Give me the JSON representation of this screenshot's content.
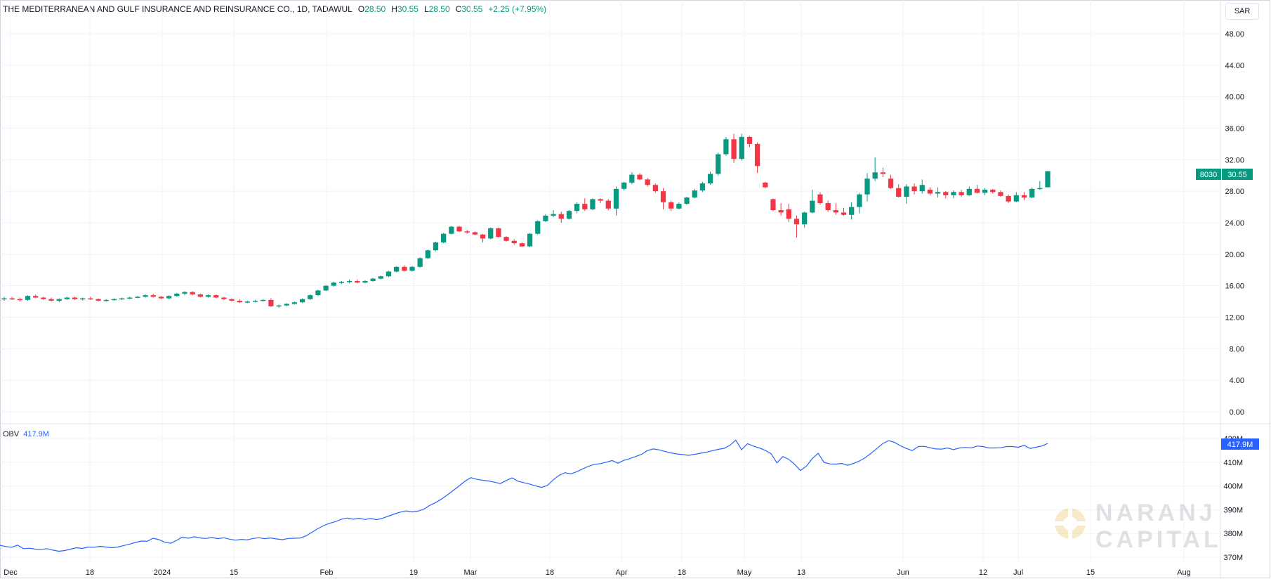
{
  "header": {
    "title": "THE MEDITERRANEAN AND GULF INSURANCE AND REINSURANCE CO., 1D, TADAWUL",
    "open_label": "O",
    "open": "28.50",
    "high_label": "H",
    "high": "30.55",
    "low_label": "L",
    "low": "28.50",
    "close_label": "C",
    "close": "30.55",
    "change": "+2.25 (+7.95%)"
  },
  "currency": "SAR",
  "price_tag": {
    "symbol": "8030",
    "value": "30.55"
  },
  "obv_legend": {
    "name": "OBV",
    "value": "417.9M"
  },
  "obv_tag": "417.9M",
  "watermark": {
    "line1": "NARANJ",
    "line2": "CAPITAL"
  },
  "colors": {
    "up": "#089981",
    "down": "#f23645",
    "obv": "#2962ff",
    "grid": "#f0f3fa",
    "axis_text": "#131722"
  },
  "chart_data": [
    {
      "type": "candlestick",
      "title": "THE MEDITERRANEAN AND GULF INSURANCE AND REINSURANCE CO., 1D, TADAWUL",
      "y_ticks": [
        "48.00",
        "44.00",
        "40.00",
        "36.00",
        "32.00",
        "28.00",
        "24.00",
        "20.00",
        "16.00",
        "12.00",
        "8.00",
        "4.00",
        "0.00"
      ],
      "ylim": [
        0,
        50
      ],
      "x_ticks": [
        "Dec",
        "18",
        "2024",
        "15",
        "Feb",
        "19",
        "Mar",
        "18",
        "Apr",
        "18",
        "May",
        "13",
        "Jun",
        "12",
        "Jul",
        "15",
        "Aug"
      ],
      "grid": true,
      "candles": [
        [
          14.3,
          14.6,
          14.1,
          14.4
        ],
        [
          14.4,
          14.6,
          14.2,
          14.3
        ],
        [
          14.3,
          14.5,
          14.0,
          14.2
        ],
        [
          14.2,
          14.8,
          14.1,
          14.7
        ],
        [
          14.7,
          14.9,
          14.4,
          14.5
        ],
        [
          14.5,
          14.6,
          14.2,
          14.3
        ],
        [
          14.3,
          14.5,
          14.0,
          14.1
        ],
        [
          14.1,
          14.4,
          13.9,
          14.3
        ],
        [
          14.3,
          14.6,
          14.2,
          14.5
        ],
        [
          14.5,
          14.6,
          14.2,
          14.3
        ],
        [
          14.3,
          14.5,
          14.1,
          14.4
        ],
        [
          14.4,
          14.6,
          14.2,
          14.3
        ],
        [
          14.3,
          14.4,
          14.0,
          14.1
        ],
        [
          14.1,
          14.3,
          14.0,
          14.2
        ],
        [
          14.2,
          14.4,
          14.1,
          14.3
        ],
        [
          14.3,
          14.5,
          14.2,
          14.4
        ],
        [
          14.4,
          14.6,
          14.3,
          14.5
        ],
        [
          14.5,
          14.7,
          14.4,
          14.6
        ],
        [
          14.6,
          14.9,
          14.5,
          14.8
        ],
        [
          14.8,
          15.0,
          14.5,
          14.6
        ],
        [
          14.6,
          14.7,
          14.3,
          14.4
        ],
        [
          14.4,
          14.8,
          14.3,
          14.7
        ],
        [
          14.7,
          15.1,
          14.6,
          15.0
        ],
        [
          15.0,
          15.3,
          14.8,
          15.2
        ],
        [
          15.2,
          15.3,
          14.8,
          14.9
        ],
        [
          14.9,
          15.0,
          14.5,
          14.6
        ],
        [
          14.6,
          14.9,
          14.5,
          14.8
        ],
        [
          14.8,
          14.9,
          14.4,
          14.5
        ],
        [
          14.5,
          14.6,
          14.2,
          14.3
        ],
        [
          14.3,
          14.4,
          14.0,
          14.1
        ],
        [
          14.1,
          14.3,
          13.8,
          13.9
        ],
        [
          13.9,
          14.1,
          13.8,
          14.0
        ],
        [
          14.0,
          14.2,
          13.9,
          14.1
        ],
        [
          14.1,
          14.3,
          14.0,
          14.2
        ],
        [
          14.2,
          14.4,
          13.3,
          13.4
        ],
        [
          13.4,
          13.6,
          13.2,
          13.5
        ],
        [
          13.5,
          13.8,
          13.4,
          13.7
        ],
        [
          13.7,
          14.0,
          13.6,
          13.9
        ],
        [
          13.9,
          14.4,
          13.8,
          14.3
        ],
        [
          14.3,
          14.9,
          14.2,
          14.8
        ],
        [
          14.8,
          15.5,
          14.7,
          15.4
        ],
        [
          15.4,
          16.1,
          15.3,
          16.0
        ],
        [
          16.0,
          16.5,
          15.9,
          16.4
        ],
        [
          16.4,
          16.6,
          16.2,
          16.5
        ],
        [
          16.5,
          16.8,
          16.3,
          16.6
        ],
        [
          16.6,
          16.8,
          16.3,
          16.4
        ],
        [
          16.4,
          16.7,
          16.3,
          16.6
        ],
        [
          16.6,
          17.0,
          16.5,
          16.9
        ],
        [
          16.9,
          17.3,
          16.8,
          17.2
        ],
        [
          17.2,
          17.9,
          17.1,
          17.8
        ],
        [
          17.8,
          18.5,
          17.7,
          18.4
        ],
        [
          18.4,
          18.6,
          17.8,
          17.9
        ],
        [
          17.9,
          18.5,
          17.8,
          18.4
        ],
        [
          18.4,
          19.6,
          18.3,
          19.5
        ],
        [
          19.5,
          20.6,
          19.4,
          20.5
        ],
        [
          20.5,
          21.6,
          20.4,
          21.5
        ],
        [
          21.5,
          22.7,
          21.4,
          22.6
        ],
        [
          22.6,
          23.6,
          22.5,
          23.5
        ],
        [
          23.5,
          23.6,
          22.8,
          22.9
        ],
        [
          22.9,
          23.1,
          22.6,
          22.8
        ],
        [
          22.8,
          22.9,
          22.4,
          22.5
        ],
        [
          22.5,
          22.6,
          21.5,
          22.0
        ],
        [
          22.0,
          23.4,
          21.9,
          23.3
        ],
        [
          23.3,
          23.4,
          22.1,
          22.2
        ],
        [
          22.2,
          22.3,
          21.6,
          21.7
        ],
        [
          21.7,
          21.9,
          21.2,
          21.4
        ],
        [
          21.4,
          21.5,
          20.9,
          21.0
        ],
        [
          21.0,
          22.7,
          20.9,
          22.6
        ],
        [
          22.6,
          24.3,
          22.5,
          24.2
        ],
        [
          24.2,
          25.1,
          24.1,
          24.9
        ],
        [
          24.9,
          25.6,
          24.7,
          25.1
        ],
        [
          25.1,
          25.4,
          24.0,
          24.5
        ],
        [
          24.5,
          25.6,
          24.4,
          25.5
        ],
        [
          25.5,
          26.6,
          25.2,
          26.4
        ],
        [
          26.4,
          27.1,
          25.5,
          25.7
        ],
        [
          25.7,
          27.1,
          25.6,
          27.0
        ],
        [
          27.0,
          27.1,
          26.5,
          26.8
        ],
        [
          26.8,
          27.0,
          25.6,
          25.8
        ],
        [
          25.8,
          28.6,
          24.9,
          28.3
        ],
        [
          28.3,
          29.2,
          28.1,
          29.1
        ],
        [
          29.1,
          30.4,
          28.9,
          30.1
        ],
        [
          30.1,
          30.3,
          29.4,
          29.5
        ],
        [
          29.5,
          29.7,
          28.6,
          28.8
        ],
        [
          28.8,
          29.0,
          27.8,
          28.0
        ],
        [
          28.0,
          28.4,
          25.7,
          26.6
        ],
        [
          26.6,
          26.8,
          25.5,
          25.8
        ],
        [
          25.8,
          26.6,
          25.7,
          26.4
        ],
        [
          26.4,
          27.3,
          26.3,
          27.2
        ],
        [
          27.2,
          28.3,
          27.1,
          28.1
        ],
        [
          28.1,
          29.2,
          27.9,
          29.0
        ],
        [
          29.0,
          30.5,
          28.8,
          30.2
        ],
        [
          30.2,
          32.9,
          30.0,
          32.7
        ],
        [
          32.7,
          34.9,
          32.5,
          34.6
        ],
        [
          34.6,
          35.3,
          31.6,
          32.1
        ],
        [
          32.1,
          35.3,
          31.9,
          34.9
        ],
        [
          34.9,
          35.0,
          33.6,
          34.0
        ],
        [
          34.0,
          34.2,
          30.3,
          31.2
        ],
        [
          29.1,
          29.2,
          28.4,
          28.5
        ],
        [
          27.0,
          27.1,
          25.5,
          25.6
        ],
        [
          25.6,
          26.5,
          24.9,
          25.3
        ],
        [
          25.7,
          26.4,
          24.1,
          24.5
        ],
        [
          24.5,
          24.9,
          22.1,
          23.8
        ],
        [
          23.8,
          25.4,
          23.4,
          25.3
        ],
        [
          25.3,
          28.2,
          25.2,
          26.8
        ],
        [
          27.6,
          27.9,
          26.3,
          26.5
        ],
        [
          26.5,
          26.8,
          25.4,
          25.6
        ],
        [
          25.6,
          26.5,
          25.0,
          25.3
        ],
        [
          25.3,
          25.9,
          24.9,
          25.0
        ],
        [
          25.0,
          26.6,
          24.4,
          26.0
        ],
        [
          26.0,
          27.8,
          25.2,
          27.6
        ],
        [
          27.6,
          30.3,
          26.7,
          29.6
        ],
        [
          29.6,
          32.3,
          29.3,
          30.4
        ],
        [
          30.4,
          31.0,
          29.8,
          30.2
        ],
        [
          29.6,
          30.1,
          28.3,
          28.4
        ],
        [
          28.4,
          28.9,
          27.2,
          27.3
        ],
        [
          27.3,
          28.9,
          26.4,
          28.6
        ],
        [
          28.6,
          29.0,
          27.6,
          28.0
        ],
        [
          28.0,
          29.5,
          27.7,
          28.8
        ],
        [
          28.2,
          28.5,
          27.5,
          27.7
        ],
        [
          27.7,
          28.5,
          27.2,
          27.9
        ],
        [
          27.9,
          28.0,
          27.1,
          27.5
        ],
        [
          27.5,
          28.1,
          27.1,
          27.9
        ],
        [
          27.9,
          28.2,
          27.3,
          27.5
        ],
        [
          27.5,
          28.6,
          27.4,
          28.3
        ],
        [
          28.3,
          28.8,
          27.7,
          27.8
        ],
        [
          27.8,
          28.4,
          27.5,
          28.2
        ],
        [
          28.2,
          28.3,
          27.7,
          27.9
        ],
        [
          27.9,
          28.1,
          27.3,
          27.4
        ],
        [
          27.4,
          27.6,
          26.5,
          26.7
        ],
        [
          26.7,
          27.9,
          26.6,
          27.5
        ],
        [
          27.5,
          27.9,
          26.9,
          27.2
        ],
        [
          27.2,
          28.5,
          27.1,
          28.3
        ],
        [
          28.3,
          29.3,
          28.2,
          28.4
        ],
        [
          28.5,
          30.55,
          28.5,
          30.55
        ]
      ]
    },
    {
      "type": "line",
      "name": "OBV",
      "y_ticks": [
        "420M",
        "410M",
        "400M",
        "390M",
        "380M",
        "370M"
      ],
      "ylim": [
        368,
        422
      ],
      "values": [
        375.0,
        374.5,
        374.2,
        375.1,
        373.6,
        373.8,
        373.4,
        373.3,
        373.6,
        373.0,
        372.5,
        372.8,
        373.4,
        374.0,
        373.7,
        374.3,
        374.2,
        374.6,
        374.3,
        374.0,
        374.3,
        374.9,
        375.5,
        376.2,
        376.8,
        376.7,
        378.0,
        377.4,
        376.3,
        375.9,
        377.1,
        378.5,
        378.0,
        378.6,
        378.1,
        377.9,
        378.3,
        377.8,
        378.2,
        377.6,
        377.2,
        377.5,
        377.3,
        377.9,
        378.2,
        377.8,
        378.1,
        377.7,
        377.4,
        377.9,
        378.0,
        378.1,
        379.0,
        380.5,
        382.0,
        383.3,
        384.3,
        385.0,
        386.0,
        386.5,
        386.0,
        386.4,
        385.9,
        386.3,
        385.8,
        386.4,
        387.3,
        388.2,
        389.0,
        389.5,
        389.1,
        389.4,
        390.2,
        391.8,
        393.0,
        394.5,
        396.2,
        398.1,
        400.0,
        402.0,
        403.5,
        402.8,
        402.4,
        402.1,
        401.6,
        401.0,
        402.3,
        403.4,
        402.0,
        401.4,
        400.8,
        400.0,
        399.4,
        400.2,
        402.6,
        404.5,
        405.6,
        405.1,
        406.0,
        407.2,
        408.3,
        409.1,
        409.4,
        410.0,
        410.7,
        409.6,
        410.8,
        411.5,
        412.4,
        413.3,
        414.9,
        415.6,
        415.2,
        414.5,
        413.9,
        413.5,
        413.2,
        412.9,
        413.3,
        413.8,
        414.2,
        414.8,
        415.4,
        415.8,
        417.1,
        419.3,
        415.3,
        417.8,
        416.8,
        416.0,
        415.0,
        413.6,
        409.7,
        412.4,
        411.2,
        409.1,
        406.5,
        408.3,
        411.5,
        413.8,
        409.9,
        409.3,
        409.2,
        409.5,
        408.7,
        409.5,
        410.5,
        411.9,
        413.8,
        415.8,
        417.9,
        419.1,
        418.3,
        416.9,
        415.8,
        414.9,
        416.6,
        416.7,
        416.1,
        415.6,
        415.5,
        416.0,
        415.3,
        416.0,
        416.2,
        416.0,
        416.8,
        416.6,
        416.0,
        416.0,
        416.1,
        416.6,
        416.6,
        416.3,
        417.1,
        415.8,
        416.3,
        416.8,
        417.9
      ]
    }
  ]
}
